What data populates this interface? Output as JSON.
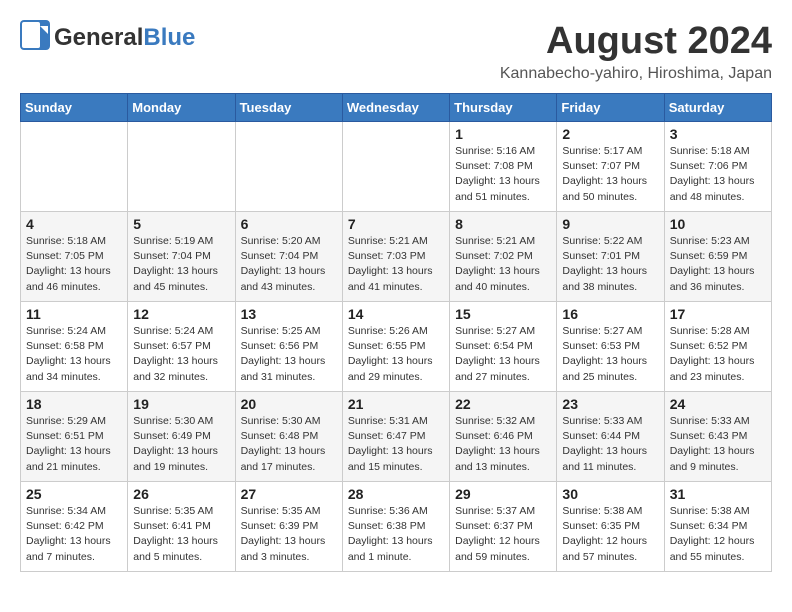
{
  "header": {
    "logo_general": "General",
    "logo_blue": "Blue",
    "month": "August 2024",
    "location": "Kannabecho-yahiro, Hiroshima, Japan"
  },
  "weekdays": [
    "Sunday",
    "Monday",
    "Tuesday",
    "Wednesday",
    "Thursday",
    "Friday",
    "Saturday"
  ],
  "weeks": [
    [
      {
        "day": "",
        "info": ""
      },
      {
        "day": "",
        "info": ""
      },
      {
        "day": "",
        "info": ""
      },
      {
        "day": "",
        "info": ""
      },
      {
        "day": "1",
        "info": "Sunrise: 5:16 AM\nSunset: 7:08 PM\nDaylight: 13 hours\nand 51 minutes."
      },
      {
        "day": "2",
        "info": "Sunrise: 5:17 AM\nSunset: 7:07 PM\nDaylight: 13 hours\nand 50 minutes."
      },
      {
        "day": "3",
        "info": "Sunrise: 5:18 AM\nSunset: 7:06 PM\nDaylight: 13 hours\nand 48 minutes."
      }
    ],
    [
      {
        "day": "4",
        "info": "Sunrise: 5:18 AM\nSunset: 7:05 PM\nDaylight: 13 hours\nand 46 minutes."
      },
      {
        "day": "5",
        "info": "Sunrise: 5:19 AM\nSunset: 7:04 PM\nDaylight: 13 hours\nand 45 minutes."
      },
      {
        "day": "6",
        "info": "Sunrise: 5:20 AM\nSunset: 7:04 PM\nDaylight: 13 hours\nand 43 minutes."
      },
      {
        "day": "7",
        "info": "Sunrise: 5:21 AM\nSunset: 7:03 PM\nDaylight: 13 hours\nand 41 minutes."
      },
      {
        "day": "8",
        "info": "Sunrise: 5:21 AM\nSunset: 7:02 PM\nDaylight: 13 hours\nand 40 minutes."
      },
      {
        "day": "9",
        "info": "Sunrise: 5:22 AM\nSunset: 7:01 PM\nDaylight: 13 hours\nand 38 minutes."
      },
      {
        "day": "10",
        "info": "Sunrise: 5:23 AM\nSunset: 6:59 PM\nDaylight: 13 hours\nand 36 minutes."
      }
    ],
    [
      {
        "day": "11",
        "info": "Sunrise: 5:24 AM\nSunset: 6:58 PM\nDaylight: 13 hours\nand 34 minutes."
      },
      {
        "day": "12",
        "info": "Sunrise: 5:24 AM\nSunset: 6:57 PM\nDaylight: 13 hours\nand 32 minutes."
      },
      {
        "day": "13",
        "info": "Sunrise: 5:25 AM\nSunset: 6:56 PM\nDaylight: 13 hours\nand 31 minutes."
      },
      {
        "day": "14",
        "info": "Sunrise: 5:26 AM\nSunset: 6:55 PM\nDaylight: 13 hours\nand 29 minutes."
      },
      {
        "day": "15",
        "info": "Sunrise: 5:27 AM\nSunset: 6:54 PM\nDaylight: 13 hours\nand 27 minutes."
      },
      {
        "day": "16",
        "info": "Sunrise: 5:27 AM\nSunset: 6:53 PM\nDaylight: 13 hours\nand 25 minutes."
      },
      {
        "day": "17",
        "info": "Sunrise: 5:28 AM\nSunset: 6:52 PM\nDaylight: 13 hours\nand 23 minutes."
      }
    ],
    [
      {
        "day": "18",
        "info": "Sunrise: 5:29 AM\nSunset: 6:51 PM\nDaylight: 13 hours\nand 21 minutes."
      },
      {
        "day": "19",
        "info": "Sunrise: 5:30 AM\nSunset: 6:49 PM\nDaylight: 13 hours\nand 19 minutes."
      },
      {
        "day": "20",
        "info": "Sunrise: 5:30 AM\nSunset: 6:48 PM\nDaylight: 13 hours\nand 17 minutes."
      },
      {
        "day": "21",
        "info": "Sunrise: 5:31 AM\nSunset: 6:47 PM\nDaylight: 13 hours\nand 15 minutes."
      },
      {
        "day": "22",
        "info": "Sunrise: 5:32 AM\nSunset: 6:46 PM\nDaylight: 13 hours\nand 13 minutes."
      },
      {
        "day": "23",
        "info": "Sunrise: 5:33 AM\nSunset: 6:44 PM\nDaylight: 13 hours\nand 11 minutes."
      },
      {
        "day": "24",
        "info": "Sunrise: 5:33 AM\nSunset: 6:43 PM\nDaylight: 13 hours\nand 9 minutes."
      }
    ],
    [
      {
        "day": "25",
        "info": "Sunrise: 5:34 AM\nSunset: 6:42 PM\nDaylight: 13 hours\nand 7 minutes."
      },
      {
        "day": "26",
        "info": "Sunrise: 5:35 AM\nSunset: 6:41 PM\nDaylight: 13 hours\nand 5 minutes."
      },
      {
        "day": "27",
        "info": "Sunrise: 5:35 AM\nSunset: 6:39 PM\nDaylight: 13 hours\nand 3 minutes."
      },
      {
        "day": "28",
        "info": "Sunrise: 5:36 AM\nSunset: 6:38 PM\nDaylight: 13 hours\nand 1 minute."
      },
      {
        "day": "29",
        "info": "Sunrise: 5:37 AM\nSunset: 6:37 PM\nDaylight: 12 hours\nand 59 minutes."
      },
      {
        "day": "30",
        "info": "Sunrise: 5:38 AM\nSunset: 6:35 PM\nDaylight: 12 hours\nand 57 minutes."
      },
      {
        "day": "31",
        "info": "Sunrise: 5:38 AM\nSunset: 6:34 PM\nDaylight: 12 hours\nand 55 minutes."
      }
    ]
  ]
}
